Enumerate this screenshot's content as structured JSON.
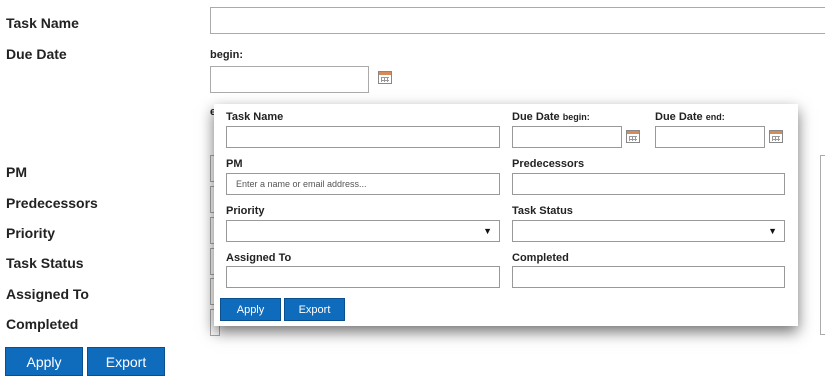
{
  "form": {
    "task_name_label": "Task Name",
    "due_date_label": "Due Date",
    "begin_label": "begin:",
    "end_label_partial": "e",
    "pm_label": "PM",
    "predecessors_label": "Predecessors",
    "priority_label": "Priority",
    "task_status_label": "Task Status",
    "assigned_to_label": "Assigned To",
    "completed_label": "Completed",
    "apply_label": "Apply",
    "export_label": "Export"
  },
  "panel": {
    "task_name_label": "Task Name",
    "due_date_label": "Due Date",
    "begin_sub": "begin:",
    "end_sub": "end:",
    "pm_label": "PM",
    "pm_placeholder": "Enter a name or email address...",
    "predecessors_label": "Predecessors",
    "priority_label": "Priority",
    "task_status_label": "Task Status",
    "assigned_to_label": "Assigned To",
    "completed_label": "Completed",
    "apply_label": "Apply",
    "export_label": "Export",
    "dropdown_caret": "▼"
  },
  "colors": {
    "button_blue": "#0f6cbd"
  },
  "icons": [
    "calendar-icon",
    "chevron-down-icon"
  ]
}
